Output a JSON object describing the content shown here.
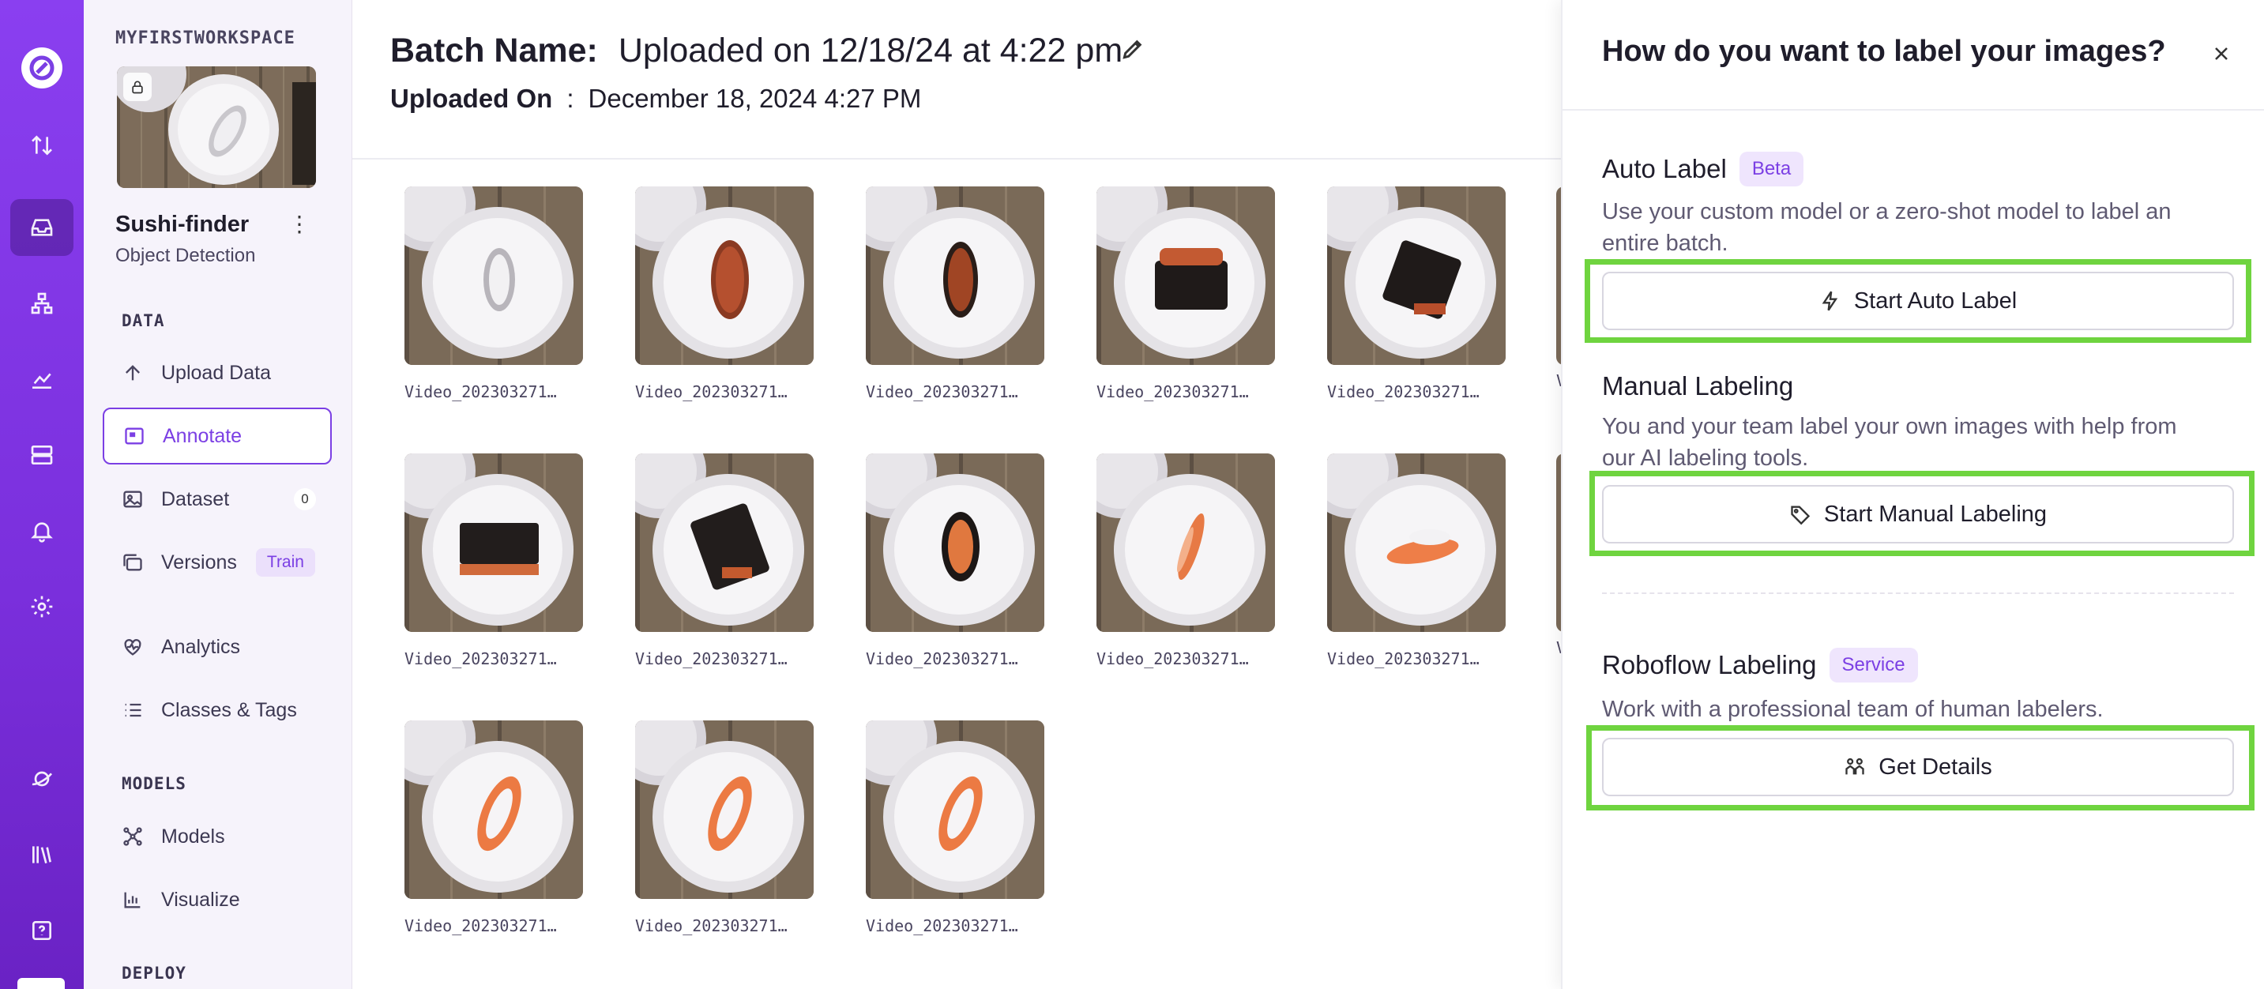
{
  "workspace": {
    "name": "MYFIRSTWORKSPACE"
  },
  "project": {
    "name": "Sushi-finder",
    "type": "Object Detection"
  },
  "nav": {
    "data_section": "DATA",
    "upload": "Upload Data",
    "annotate": "Annotate",
    "dataset": "Dataset",
    "dataset_count": "0",
    "versions": "Versions",
    "versions_badge": "Train",
    "analytics": "Analytics",
    "classes": "Classes & Tags",
    "models_section": "MODELS",
    "models": "Models",
    "visualize": "Visualize",
    "deploy_section": "DEPLOY"
  },
  "header": {
    "batch_label": "Batch Name:",
    "batch_value": "Uploaded on 12/18/24 at 4:22 pm",
    "uploaded_label": "Uploaded On",
    "uploaded_sep": ":",
    "uploaded_value": "December 18, 2024 4:27 PM"
  },
  "images": [
    {
      "caption": "Video_202303271…",
      "food": "rice"
    },
    {
      "caption": "Video_202303271…",
      "food": "roe"
    },
    {
      "caption": "Video_202303271…",
      "food": "roe-dark"
    },
    {
      "caption": "Video_202303271…",
      "food": "nori-roe"
    },
    {
      "caption": "Video_202303271…",
      "food": "nori-dark"
    },
    {
      "caption": "Video_202303271…",
      "food": "nori-rect"
    },
    {
      "caption": "Video_202303271…",
      "food": "nori-tilt"
    },
    {
      "caption": "Video_202303271…",
      "food": "roe-oval"
    },
    {
      "caption": "Video_202303271…",
      "food": "salmon-thin"
    },
    {
      "caption": "Video_202303271…",
      "food": "salmon-flat"
    },
    {
      "caption": "Video_202303271…",
      "food": "salmon"
    },
    {
      "caption": "Video_202303271…",
      "food": "salmon"
    },
    {
      "caption": "Video_202303271…",
      "food": "salmon"
    }
  ],
  "partial_captions": [
    "V",
    "V"
  ],
  "panel": {
    "title": "How do you want to label your images?",
    "auto": {
      "title": "Auto Label",
      "badge": "Beta",
      "desc": "Use your custom model or a zero-shot model to label an entire batch.",
      "button": "Start Auto Label"
    },
    "manual": {
      "title": "Manual Labeling",
      "desc": "You and your team label your own images with help from our AI labeling tools.",
      "button": "Start Manual Labeling"
    },
    "roboflow": {
      "title": "Roboflow Labeling",
      "badge": "Service",
      "desc": "Work with a professional team of human labelers.",
      "button": "Get Details"
    }
  },
  "colors": {
    "brand": "#7b3fe4",
    "highlight": "#6fd43f"
  }
}
